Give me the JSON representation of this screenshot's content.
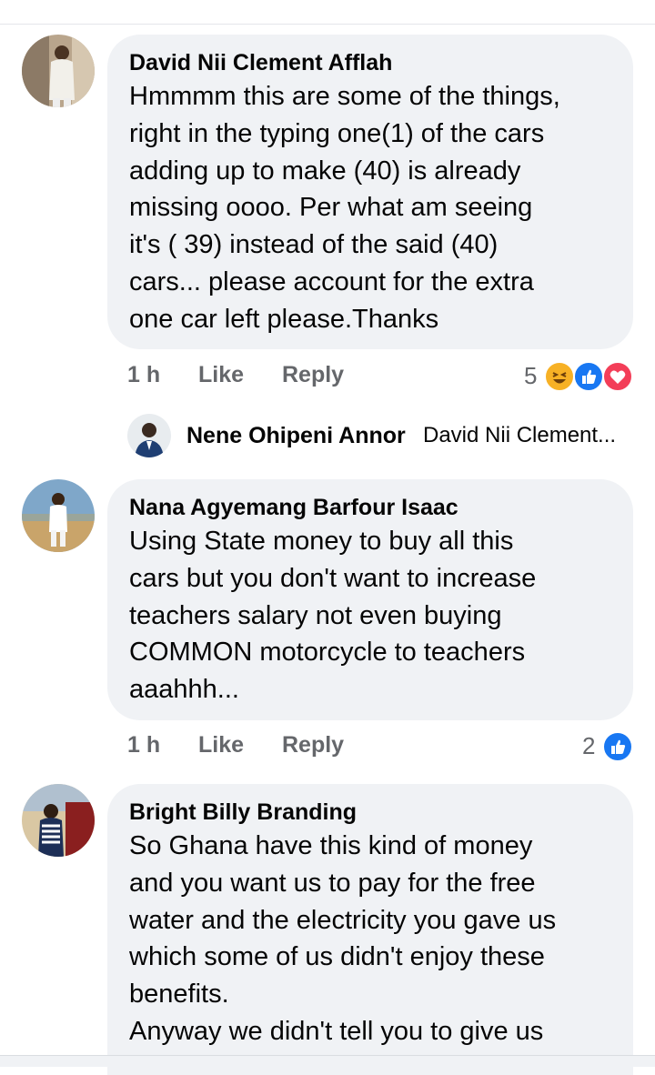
{
  "comments": [
    {
      "author": "David Nii Clement Afflah",
      "text": "Hmmmm this are some of the things,\nright in the typing  one(1) of the cars\nadding up to make (40) is already\nmissing oooo. Per what am seeing\nit's ( 39) instead of the said (40)\ncars... please account for the extra\none car left please.Thanks",
      "time": "1 h",
      "like_label": "Like",
      "reply_label": "Reply",
      "reaction_count": "5",
      "reactions": [
        "haha-icon",
        "like-icon",
        "love-icon"
      ]
    },
    {
      "author": "Nana Agyemang Barfour Isaac",
      "text": "Using State money to buy all this\ncars but you don't want to increase\nteachers salary not even buying\nCOMMON motorcycle to teachers\naaahhh...",
      "time": "1 h",
      "like_label": "Like",
      "reply_label": "Reply",
      "reaction_count": "2",
      "reactions": [
        "like-icon"
      ]
    },
    {
      "author": "Bright Billy Branding",
      "text": "So Ghana have this kind of money\nand you want us to pay for the free\nwater and the electricity you gave us\nwhich some of us didn't enjoy these\nbenefits.\nAnyway we didn't tell you to give us"
    }
  ],
  "reply_preview": {
    "name": "Nene Ohipeni Annor",
    "snippet": "David Nii Clement..."
  },
  "colors": {
    "bubble": "#f0f2f5",
    "meta_text": "#65676b",
    "like_blue": "#1877f2",
    "love_red": "#f33e58",
    "haha_yellow": "#f7b125"
  }
}
